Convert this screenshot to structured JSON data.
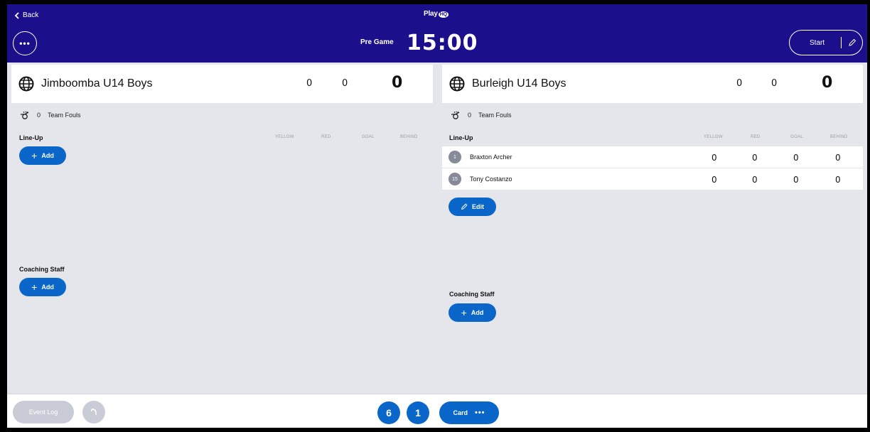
{
  "header": {
    "back_label": "Back",
    "logo_text": "PlayHQ",
    "logo_badge": "HQ",
    "menu_label": "•••",
    "period": "Pre Game",
    "clock": "15:00",
    "start_label": "Start"
  },
  "home": {
    "name": "Jimboomba U14 Boys",
    "score_a": "0",
    "score_b": "0",
    "score_total": "0",
    "fouls_count": "0",
    "fouls_label": "Team Fouls",
    "lineup_label": "Line-Up",
    "columns": [
      "YELLOW",
      "RED",
      "GOAL",
      "BEHIND"
    ],
    "add_label": "Add",
    "coaching_label": "Coaching Staff",
    "coaching_add_label": "Add"
  },
  "away": {
    "name": "Burleigh U14 Boys",
    "score_a": "0",
    "score_b": "0",
    "score_total": "0",
    "fouls_count": "0",
    "fouls_label": "Team Fouls",
    "lineup_label": "Line-Up",
    "columns": [
      "YELLOW",
      "RED",
      "GOAL",
      "BEHIND"
    ],
    "players": [
      {
        "number": "1",
        "name": "Braxton Archer",
        "yellow": "0",
        "red": "0",
        "goal": "0",
        "behind": "0"
      },
      {
        "number": "15",
        "name": "Tony Costanzo",
        "yellow": "0",
        "red": "0",
        "goal": "0",
        "behind": "0"
      }
    ],
    "edit_label": "Edit",
    "coaching_label": "Coaching Staff",
    "coaching_add_label": "Add"
  },
  "footer": {
    "event_log_label": "Event Log",
    "count_a": "6",
    "count_b": "1",
    "card_label": "Card",
    "card_more": "•••"
  },
  "colors": {
    "header_bg": "#1c0f8c",
    "accent": "#0a67c9",
    "page_bg": "#e4e6ec"
  }
}
